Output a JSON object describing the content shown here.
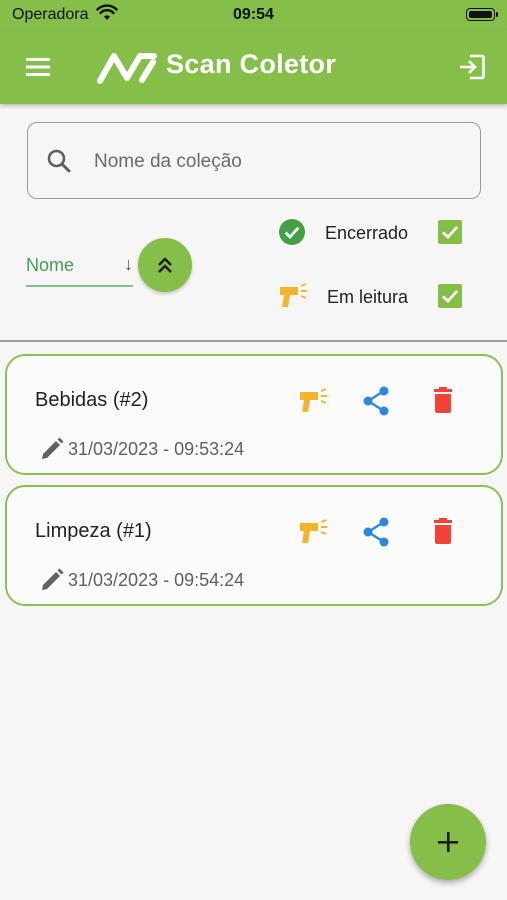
{
  "status_bar": {
    "carrier": "Operadora",
    "time": "09:54"
  },
  "app_bar": {
    "title": "Scan Coletor"
  },
  "search": {
    "placeholder": "Nome da coleção",
    "value": ""
  },
  "sort": {
    "field_label": "Nome",
    "direction_icon": "↓"
  },
  "filters": [
    {
      "label": "Encerrado",
      "checked": true
    },
    {
      "label": "Em leitura",
      "checked": true
    }
  ],
  "collections": [
    {
      "title": "Bebidas (#2)",
      "date": "31/03/2023 - 09:53:24"
    },
    {
      "title": "Limpeza (#1)",
      "date": "31/03/2023 - 09:54:24"
    }
  ],
  "colors": {
    "primary": "#85bf4a",
    "card_border": "#8cc152",
    "sort_underline": "#7cc48d",
    "scanner_icon": "#f4b52c",
    "share_icon": "#2b88e0",
    "delete_icon": "#f44336",
    "encerrado_icon": "#43a047"
  }
}
